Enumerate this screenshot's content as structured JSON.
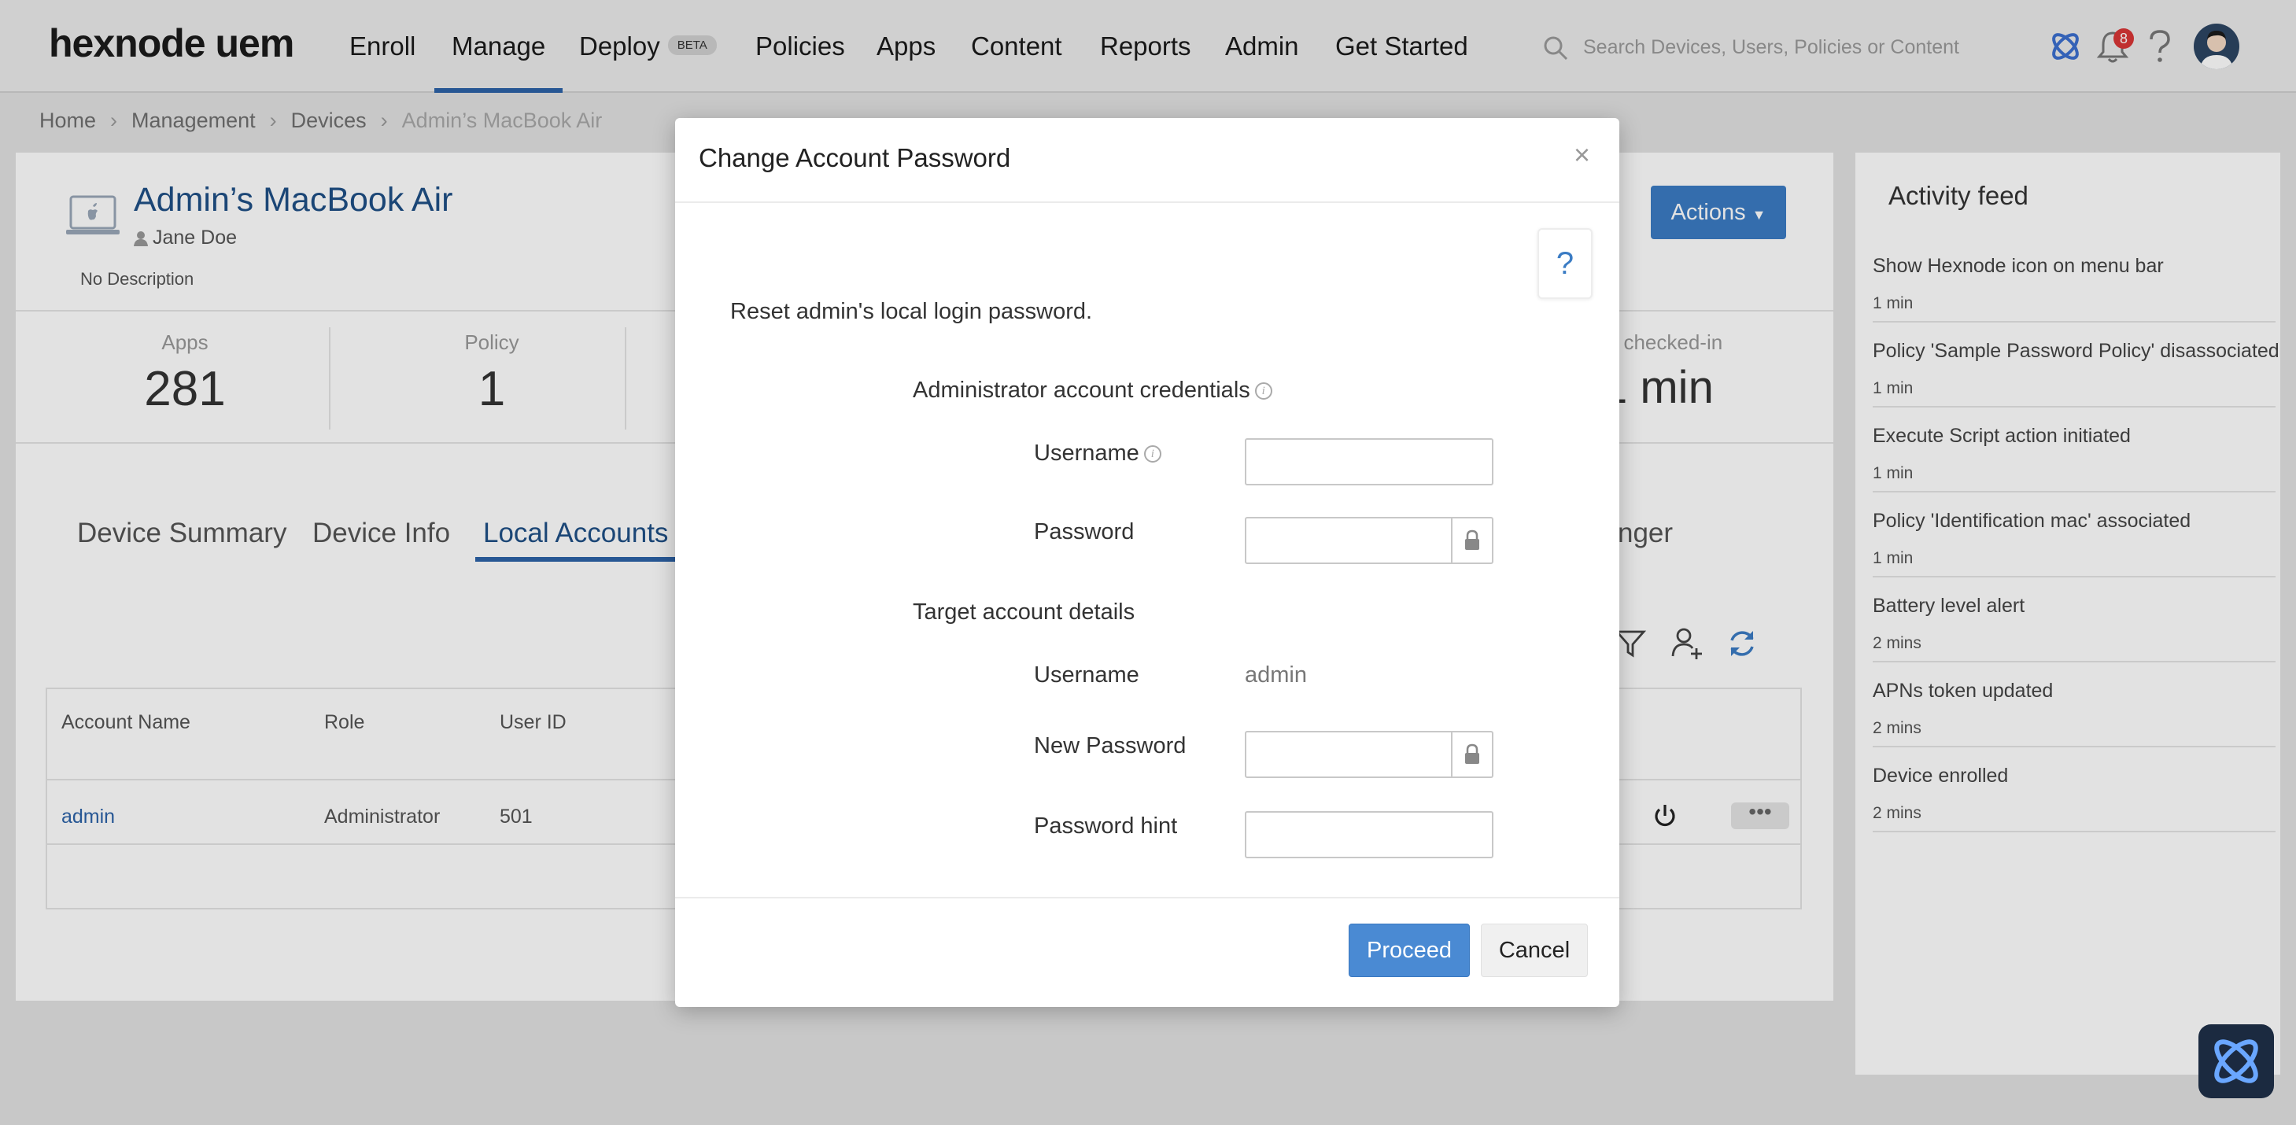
{
  "brand": {
    "logo": "hexnode uem"
  },
  "nav": {
    "items": [
      {
        "label": "Enroll"
      },
      {
        "label": "Manage"
      },
      {
        "label": "Deploy"
      },
      {
        "label": "Policies"
      },
      {
        "label": "Apps"
      },
      {
        "label": "Content"
      },
      {
        "label": "Reports"
      },
      {
        "label": "Admin"
      },
      {
        "label": "Get Started"
      }
    ],
    "active": "Manage",
    "deploy_badge": "BETA"
  },
  "search": {
    "placeholder": "Search Devices, Users, Policies or Content"
  },
  "header": {
    "notification_count": "8"
  },
  "breadcrumb": [
    "Home",
    "Management",
    "Devices",
    "Admin’s MacBook Air"
  ],
  "device": {
    "name": "Admin’s MacBook Air",
    "user": "Jane Doe",
    "description": "No Description",
    "actions_label": "Actions"
  },
  "stats": [
    {
      "label": "Apps",
      "value": "281"
    },
    {
      "label": "Policy",
      "value": "1"
    },
    {
      "label": "st checked-in",
      "value": "1 min"
    }
  ],
  "tabs": [
    {
      "label": "Device Summary"
    },
    {
      "label": "Device Info"
    },
    {
      "label": "Local Accounts"
    },
    {
      "label": "nger"
    }
  ],
  "accounts_table": {
    "columns": [
      "Account Name",
      "Role",
      "User ID"
    ],
    "rows": [
      {
        "account_name": "admin",
        "role": "Administrator",
        "user_id": "501",
        "extra": "("
      }
    ]
  },
  "activity_feed": {
    "title": "Activity feed",
    "items": [
      {
        "text": "Show Hexnode icon on menu bar",
        "time": "1 min"
      },
      {
        "text": "Policy 'Sample Password Policy' disassociated",
        "time": "1 min"
      },
      {
        "text": "Execute Script action initiated",
        "time": "1 min"
      },
      {
        "text": "Policy 'Identification mac' associated",
        "time": "1 min"
      },
      {
        "text": "Battery level alert",
        "time": "2 mins"
      },
      {
        "text": "APNs token updated",
        "time": "2 mins"
      },
      {
        "text": "Device enrolled",
        "time": "2 mins"
      }
    ]
  },
  "dialog": {
    "title": "Change Account Password",
    "help": "?",
    "close": "×",
    "intro": "Reset admin's local login password.",
    "admin_section": "Administrator account credentials",
    "username_label": "Username",
    "username_value": "",
    "password_label": "Password",
    "password_value": "",
    "target_section": "Target account details",
    "target_username_label": "Username",
    "target_username_value": "admin",
    "new_password_label": "New Password",
    "new_password_value": "",
    "hint_label": "Password hint",
    "hint_value": "",
    "proceed": "Proceed",
    "cancel": "Cancel"
  },
  "colors": {
    "accent": "#3b7cc4",
    "link": "#2d63a8",
    "notification_badge": "#d93636"
  }
}
